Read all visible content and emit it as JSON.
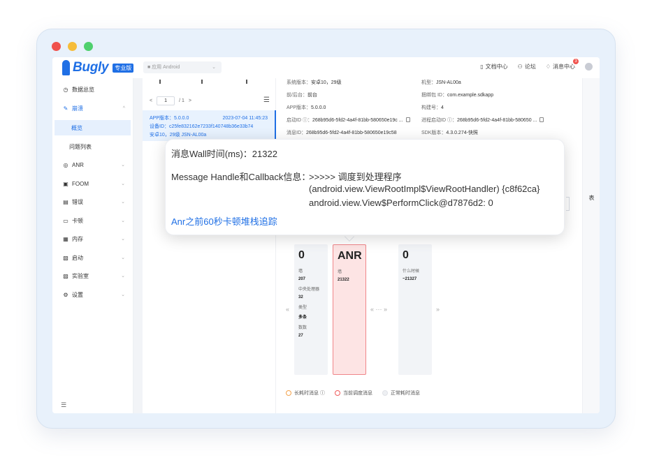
{
  "brand": {
    "name": "Bugly",
    "badge": "专业版"
  },
  "app_selector": {
    "value": "■ 应用 Android",
    "chevron": "⌄"
  },
  "topbar": {
    "docs": "文档中心",
    "forum": "论坛",
    "messages": "消息中心",
    "message_count": "3"
  },
  "sidebar": {
    "items": [
      {
        "icon": "◷",
        "label": "数据总览"
      },
      {
        "icon": "✎",
        "label": "崩溃",
        "chevron": "^"
      },
      {
        "label": "概览"
      },
      {
        "label": "问题列表"
      },
      {
        "icon": "◎",
        "label": "ANR",
        "chevron": "⌄"
      },
      {
        "icon": "▣",
        "label": "FOOM",
        "chevron": "⌄"
      },
      {
        "icon": "▤",
        "label": "错误",
        "chevron": "⌄"
      },
      {
        "icon": "▭",
        "label": "卡顿",
        "chevron": "⌄"
      },
      {
        "icon": "▦",
        "label": "内存",
        "chevron": "⌄"
      },
      {
        "icon": "▧",
        "label": "启动",
        "chevron": "⌄"
      },
      {
        "icon": "▨",
        "label": "实验室",
        "chevron": "⌄"
      },
      {
        "icon": "⚙",
        "label": "设置",
        "chevron": "⌄"
      }
    ],
    "collapse": "☰"
  },
  "list": {
    "pager": {
      "prev": "<",
      "page": "1",
      "total": "/ 1",
      "next": ">"
    },
    "menu": "☰",
    "record": {
      "app_version": "APP版本：5.0.0.0",
      "time": "2023-07-04 11:45:23",
      "device_id": "设备ID：c25fe832162e7233f140748b36e33b74",
      "os": "安卓10，29级    JSN-AL00a"
    }
  },
  "detail": {
    "system_version": {
      "k": "系统版本：",
      "v": "安卓10，29级"
    },
    "model": {
      "k": "机型：",
      "v": "JSN-AL00a"
    },
    "foreground": {
      "k": "前/后台：",
      "v": "前台"
    },
    "bundle": {
      "k": "捆绑包 ID：",
      "v": "com.example.sdkapp"
    },
    "app_version": {
      "k": "APP版本：",
      "v": "5.0.0.0"
    },
    "build": {
      "k": "构建号：",
      "v": "4"
    },
    "launch_id": {
      "k": "启动ID ⓘ：",
      "v": "268b95d6-5fd2-4a4f-81bb-580650e19c ..."
    },
    "process_launch_id": {
      "k": "进程启动ID ⓘ：",
      "v": "268b95d6-5fd2-4a4f-81bb-580650 ..."
    },
    "message_id": {
      "k": "消息ID：",
      "v": "268b95d6-5fd2-4a4f-81bb-580650e19c58"
    },
    "sdk_version": {
      "k": "SDK版本：",
      "v": "4.3.0.274-快照"
    }
  },
  "right_tab": "表",
  "columns": [
    {
      "big": "0",
      "fields": [
        {
          "lab": "墙",
          "val": "207"
        },
        {
          "lab": "中央处理器",
          "val": "32"
        },
        {
          "lab": "类型",
          "val": "多条"
        },
        {
          "lab": "数数",
          "val": "27"
        }
      ]
    },
    {
      "big": "ANR",
      "fields": [
        {
          "lab": "墙",
          "val": "21322"
        }
      ]
    },
    {
      "big": "0",
      "fields": [
        {
          "lab": "什么时候",
          "val": "~21327"
        }
      ]
    }
  ],
  "arrows": {
    "left": "«",
    "mid": "« ··· »",
    "right": "»"
  },
  "legend": [
    {
      "label": "长耗时消息 ⓘ",
      "color": "#f2a24b"
    },
    {
      "label": "当前调度消息",
      "color": "#ef5b5b"
    },
    {
      "label": "正常耗时消息",
      "color": "#e0e2e6"
    }
  ],
  "popup": {
    "wall_time": "消息Wall时间(ms)：21322",
    "handle_label": "Message Handle和Callback信息：",
    "handle_line1": ">>>>> 调度到处理程序",
    "handle_line2": "(android.view.ViewRootImpl$ViewRootHandler) {c8f62ca}",
    "handle_line3": "android.view.View$PerformClick@d7876d2: 0",
    "link": "Anr之前60秒卡顿堆栈追踪"
  }
}
